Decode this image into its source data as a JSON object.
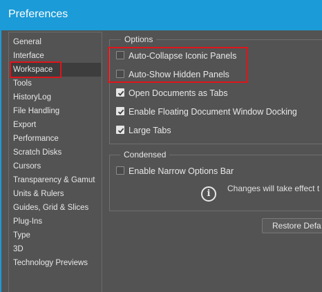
{
  "window": {
    "title": "Preferences"
  },
  "sidebar": {
    "items": [
      {
        "label": "General"
      },
      {
        "label": "Interface"
      },
      {
        "label": "Workspace",
        "selected": true
      },
      {
        "label": "Tools"
      },
      {
        "label": "HistoryLog"
      },
      {
        "label": "File Handling"
      },
      {
        "label": "Export"
      },
      {
        "label": "Performance"
      },
      {
        "label": "Scratch Disks"
      },
      {
        "label": "Cursors"
      },
      {
        "label": "Transparency & Gamut"
      },
      {
        "label": "Units & Rulers"
      },
      {
        "label": "Guides, Grid & Slices"
      },
      {
        "label": "Plug-Ins"
      },
      {
        "label": "Type"
      },
      {
        "label": "3D"
      },
      {
        "label": "Technology Previews"
      }
    ]
  },
  "options": {
    "title": "Options",
    "items": [
      {
        "label": "Auto-Collapse Iconic Panels",
        "checked": false
      },
      {
        "label": "Auto-Show Hidden Panels",
        "checked": false
      },
      {
        "label": "Open Documents as Tabs",
        "checked": true
      },
      {
        "label": "Enable Floating Document Window Docking",
        "checked": true
      },
      {
        "label": "Large Tabs",
        "checked": true
      }
    ]
  },
  "condensed": {
    "title": "Condensed",
    "narrow_bar": {
      "label": "Enable Narrow Options Bar",
      "checked": false
    },
    "notice": "Changes will take effect t"
  },
  "buttons": {
    "restore": "Restore Defa"
  },
  "colors": {
    "accent": "#1b9bd7",
    "highlight": "#e0141b",
    "panel": "#535353"
  }
}
